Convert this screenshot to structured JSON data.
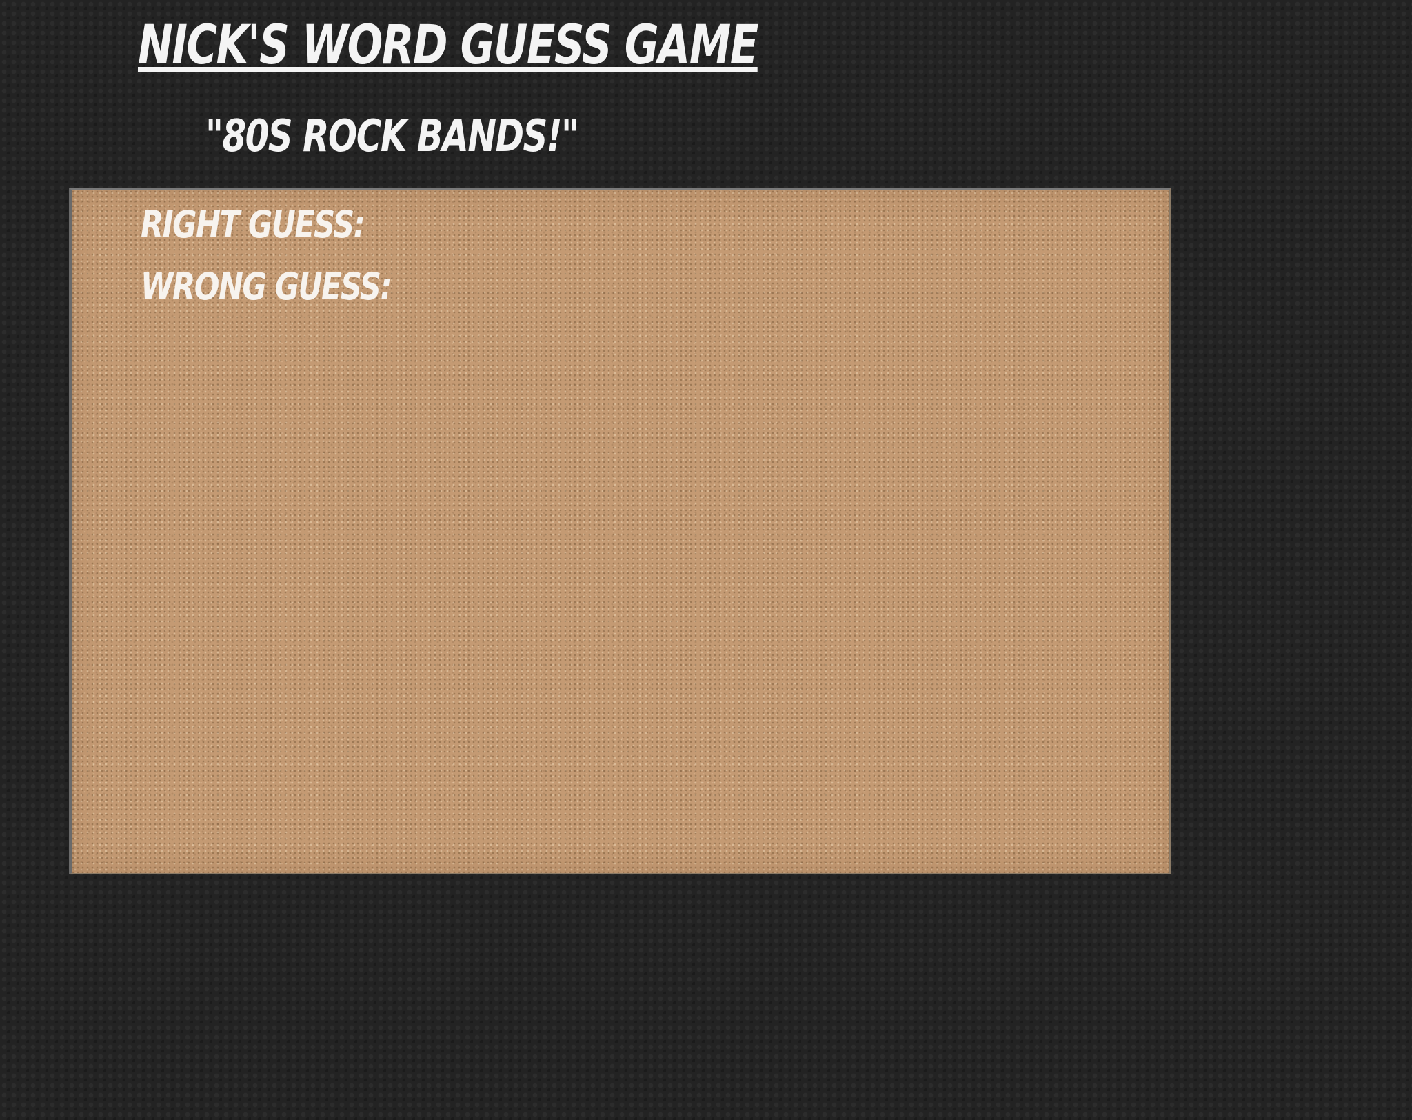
{
  "header": {
    "title": "Nick's Word Guess Game",
    "subtitle": "\"80s Rock Bands!\""
  },
  "board": {
    "right_guess_label": "Right Guess:",
    "wrong_guess_label": "Wrong Guess:"
  },
  "colors": {
    "page_background": "#232323",
    "board_cork": "#c49a73",
    "text": "#f4f4f4"
  }
}
